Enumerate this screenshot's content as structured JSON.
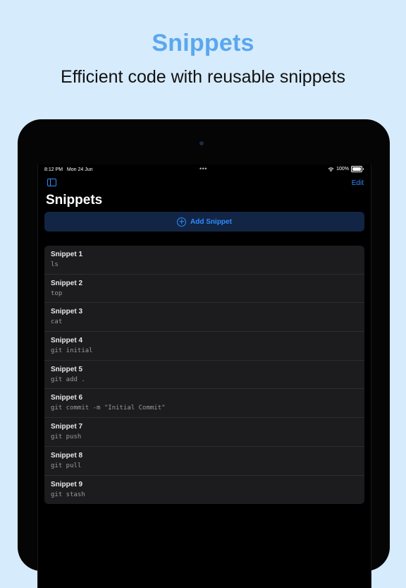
{
  "promo": {
    "title": "Snippets",
    "subtitle": "Efficient code with reusable snippets"
  },
  "status_bar": {
    "time": "8:12 PM",
    "date": "Mon 24 Jun",
    "dots": "•••",
    "battery": "100%"
  },
  "nav": {
    "edit_label": "Edit",
    "title": "Snippets"
  },
  "add_button": {
    "label": "Add Snippet"
  },
  "snippets": [
    {
      "title": "Snippet 1",
      "code": "ls"
    },
    {
      "title": "Snippet 2",
      "code": "top"
    },
    {
      "title": "Snippet 3",
      "code": "cat"
    },
    {
      "title": "Snippet 4",
      "code": "git initial"
    },
    {
      "title": "Snippet 5",
      "code": "git add ."
    },
    {
      "title": "Snippet 6",
      "code": "git commit -m \"Initial Commit\""
    },
    {
      "title": "Snippet 7",
      "code": "git push"
    },
    {
      "title": "Snippet 8",
      "code": "git pull"
    },
    {
      "title": "Snippet 9",
      "code": "git stash"
    }
  ],
  "colors": {
    "accent": "#2e8cff",
    "promo_title": "#5aa7ee",
    "background": "#d6ebfb",
    "list_bg": "#1c1c1e"
  },
  "icons": {
    "sidebar": "sidebar-icon",
    "add": "plus-circle-icon",
    "wifi": "wifi-icon",
    "battery": "battery-icon"
  }
}
